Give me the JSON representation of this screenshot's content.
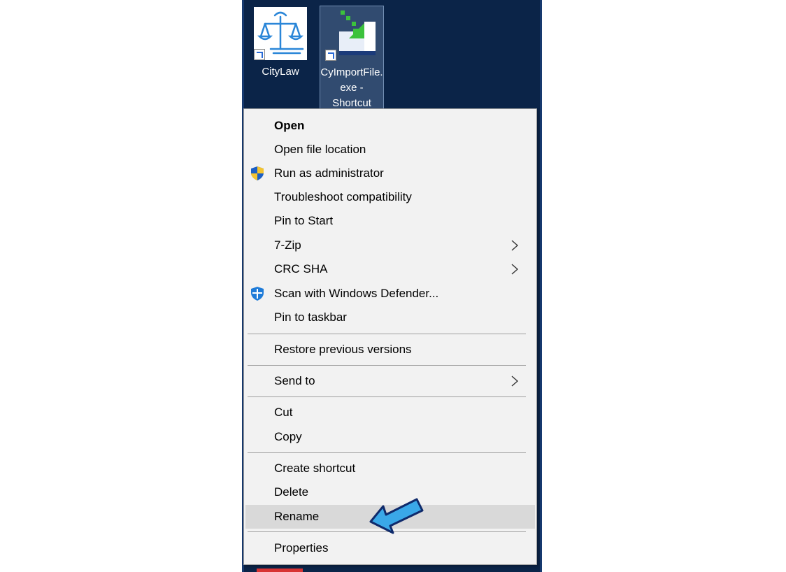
{
  "desktop": {
    "icons": [
      {
        "label": "CityLaw"
      },
      {
        "label_lines": [
          "CyImportFile.",
          "exe -",
          "Shortcut"
        ]
      }
    ]
  },
  "context_menu": {
    "items": {
      "open": "Open",
      "open_file_location": "Open file location",
      "run_as_admin": "Run as administrator",
      "troubleshoot": "Troubleshoot compatibility",
      "pin_to_start": "Pin to Start",
      "seven_zip": "7-Zip",
      "crc_sha": "CRC SHA",
      "scan_defender": "Scan with Windows Defender...",
      "pin_to_taskbar": "Pin to taskbar",
      "restore_versions": "Restore previous versions",
      "send_to": "Send to",
      "cut": "Cut",
      "copy": "Copy",
      "create_shortcut": "Create shortcut",
      "delete": "Delete",
      "rename": "Rename",
      "properties": "Properties"
    },
    "hovered_item": "Rename"
  },
  "colors": {
    "desktop_bg": "#0b2448",
    "menu_bg": "#f2f2f2",
    "hover_bg": "#d9d9d9",
    "pointer_arrow": "#3aa8e8"
  },
  "icons": [
    "scales-of-justice-icon",
    "import-file-icon",
    "shortcut-arrow-icon",
    "uac-shield-icon",
    "windows-defender-icon",
    "chevron-right-icon",
    "pointer-arrow-icon"
  ]
}
